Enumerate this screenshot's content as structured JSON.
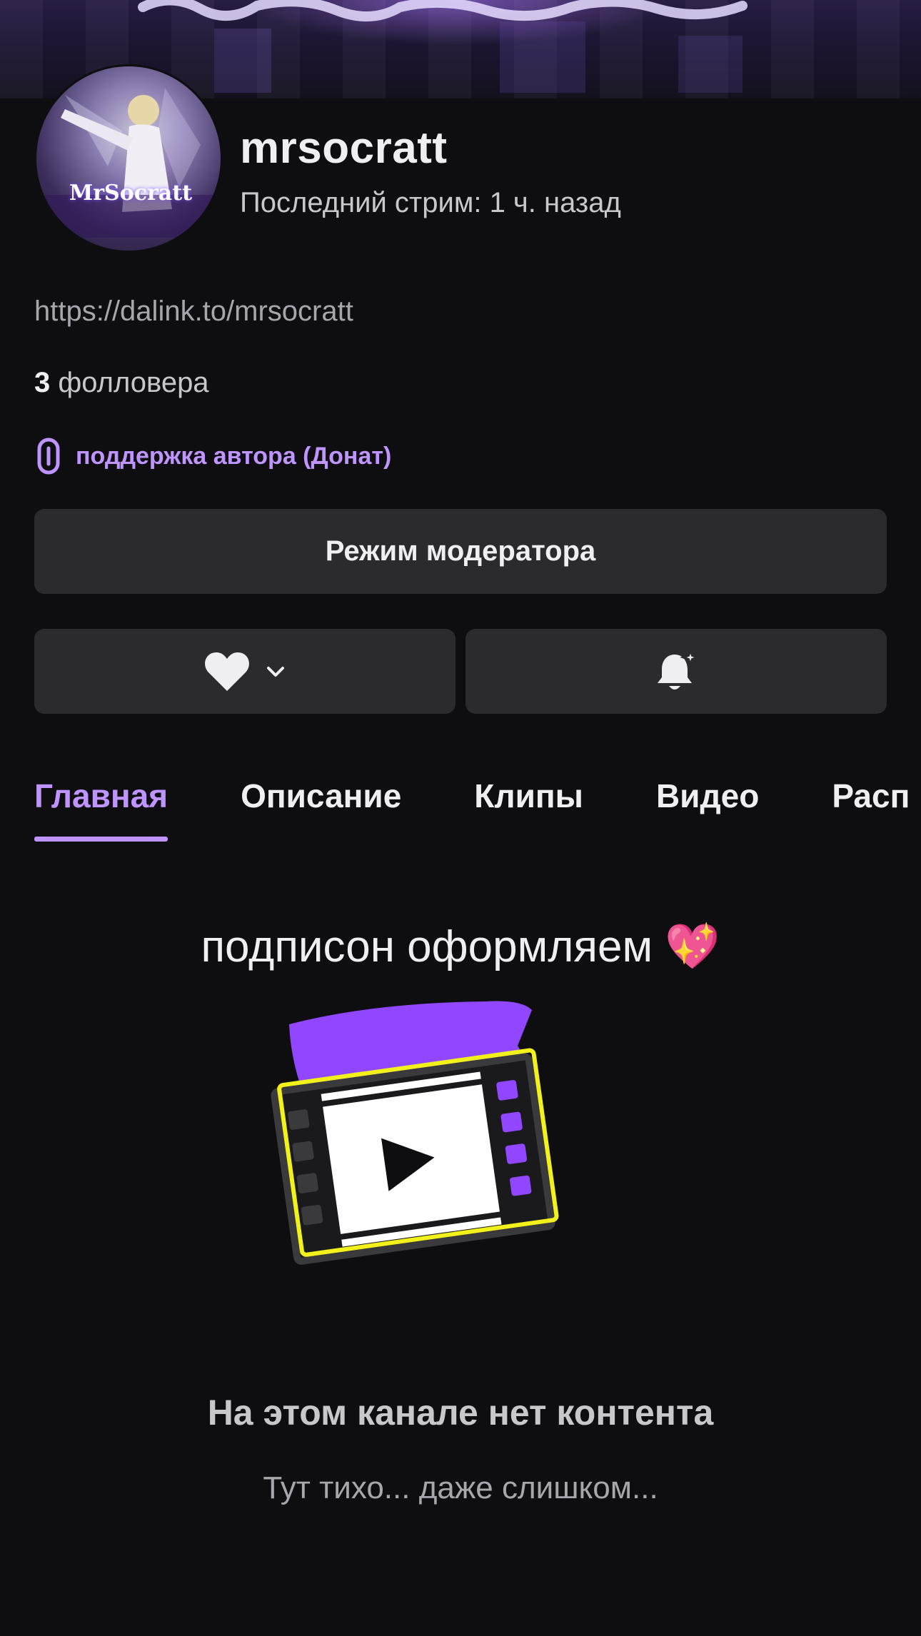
{
  "banner": {
    "image_name": "channel-banner"
  },
  "channel": {
    "avatar_icon": "avatar-image",
    "avatar_lettering": "MrSocratt",
    "name": "mrsocratt",
    "last_stream": "Последний стрим: 1 ч. назад",
    "link": "https://dalink.to/mrsocratt",
    "followers_count": "3",
    "followers_label": " фолловера"
  },
  "donate": {
    "icon": "link-icon",
    "label": "поддержка автора (Донат)",
    "color": "#bf94ff"
  },
  "buttons": {
    "moderator": "Режим модератора",
    "follow_icon": "heart-icon",
    "follow_dropdown_icon": "chevron-down-icon",
    "notify_icon": "bell-plus-icon"
  },
  "tabs": [
    {
      "label": "Главная",
      "active": true
    },
    {
      "label": "Описание",
      "active": false
    },
    {
      "label": "Клипы",
      "active": false
    },
    {
      "label": "Видео",
      "active": false
    },
    {
      "label": "Расп",
      "active": false
    }
  ],
  "main": {
    "headline": "подписон оформляем 💖",
    "illustration": "empty-video-illustration",
    "empty_title": "На этом канале нет контента",
    "empty_subtitle": "Тут тихо... даже слишком..."
  },
  "colors": {
    "background": "#0e0e10",
    "accent": "#bf94ff",
    "button": "#2a2a2f",
    "illustration_purple": "#9147ff",
    "illustration_yellow": "#f2f21a"
  }
}
